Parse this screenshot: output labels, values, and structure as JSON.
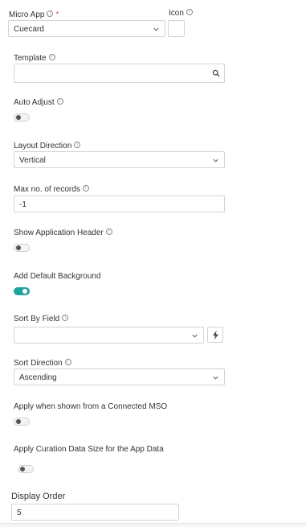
{
  "micro_app": {
    "label": "Micro App",
    "value": "Cuecard"
  },
  "icon_field": {
    "label": "Icon"
  },
  "template": {
    "label": "Template",
    "value": ""
  },
  "auto_adjust": {
    "label": "Auto Adjust",
    "on": false
  },
  "layout_direction": {
    "label": "Layout Direction",
    "value": "Vertical"
  },
  "max_records": {
    "label": "Max no. of records",
    "value": "-1"
  },
  "show_app_header": {
    "label": "Show Application Header",
    "on": false
  },
  "add_default_background": {
    "label": "Add Default Background",
    "on": true
  },
  "sort_by_field": {
    "label": "Sort By Field",
    "value": ""
  },
  "sort_direction": {
    "label": "Sort Direction",
    "value": "Ascending"
  },
  "apply_connected_mso": {
    "label": "Apply when shown from a Connected MSO",
    "on": false
  },
  "apply_curation_size": {
    "label": "Apply Curation Data Size for the App Data",
    "on": false
  },
  "display_order": {
    "label": "Display Order",
    "value": "5"
  },
  "colors": {
    "accent": "#20a39e",
    "required": "#d9534f",
    "border": "#cfd4d9"
  }
}
